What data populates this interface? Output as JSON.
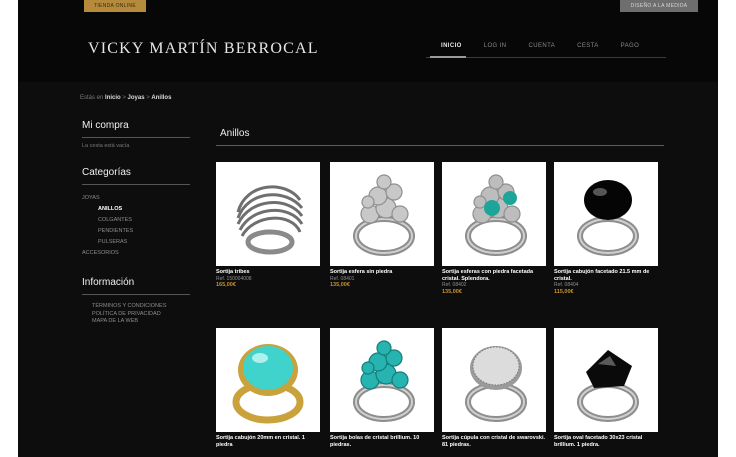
{
  "header": {
    "badge": "TIENDA ONLINE",
    "top_button": "DISEÑO A LA MEDIDA",
    "logo": "VICKY MARTÍN BERROCAL",
    "nav": [
      {
        "label": "INICIO",
        "active": true
      },
      {
        "label": "LOG IN",
        "active": false
      },
      {
        "label": "CUENTA",
        "active": false
      },
      {
        "label": "CESTA",
        "active": false
      },
      {
        "label": "PAGO",
        "active": false
      }
    ]
  },
  "breadcrumb": {
    "prefix": "Estás en",
    "items": [
      "Inicio",
      "Joyas",
      "Anillos"
    ],
    "separator": " > "
  },
  "sidebar": {
    "cart": {
      "title": "Mi compra",
      "note": "La cesta está vacía"
    },
    "categories": {
      "title": "Categorías",
      "items": [
        {
          "label": "JOYAS",
          "level": 0,
          "active": false
        },
        {
          "label": "ANILLOS",
          "level": 1,
          "active": true
        },
        {
          "label": "COLGANTES",
          "level": 1,
          "active": false
        },
        {
          "label": "PENDIENTES",
          "level": 1,
          "active": false
        },
        {
          "label": "PULSERAS",
          "level": 1,
          "active": false
        },
        {
          "label": "ACCESORIOS",
          "level": 0,
          "active": false
        }
      ]
    },
    "info": {
      "title": "Información",
      "items": [
        "TÉRMINOS Y CONDICIONES",
        "POLÍTICA DE PRIVACIDAD",
        "MAPA DE LA WEB"
      ]
    }
  },
  "main": {
    "title": "Anillos",
    "products": [
      {
        "name": "Sortija tribes",
        "ref": "Ref. 150004008",
        "price": "165,00€",
        "stone": "none",
        "stone_color": "#9a9a9a"
      },
      {
        "name": "Sortija esfera sin piedra",
        "ref": "Ref. 08401",
        "price": "135,00€",
        "stone": "pearls",
        "stone_color": "#c8c8c8"
      },
      {
        "name": "Sortija esferas con piedra facetada cristal. Splendora.",
        "ref": "Ref. 08402",
        "price": "135,00€",
        "stone": "teal",
        "stone_color": "#1ea59a"
      },
      {
        "name": "Sortija cabujón facetado 21.5 mm de cristal.",
        "ref": "Ref. 08404",
        "price": "115,00€",
        "stone": "black",
        "stone_color": "#050505"
      },
      {
        "name": "Sortija cabujón 20mm en cristal. 1 piedra",
        "ref": "",
        "price": "",
        "stone": "turquoise-gold",
        "stone_color": "#3fd3cc"
      },
      {
        "name": "Sortija bolas de cristal brillium. 10 piedras.",
        "ref": "",
        "price": "",
        "stone": "teal-cluster",
        "stone_color": "#27b3b0"
      },
      {
        "name": "Sortija cúpula con cristal de swarovski. 81 piedras.",
        "ref": "",
        "price": "",
        "stone": "dome",
        "stone_color": "#dcdcdc"
      },
      {
        "name": "Sortija oval facetado 30x23 cristal brillium. 1 piedra.",
        "ref": "",
        "price": "",
        "stone": "black-oval",
        "stone_color": "#0a0a0a"
      }
    ]
  }
}
